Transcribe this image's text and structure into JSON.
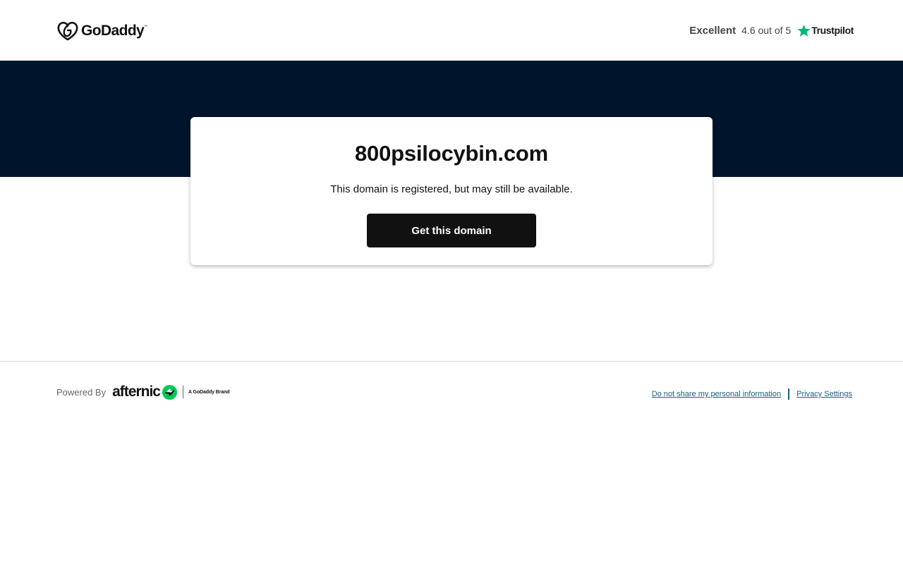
{
  "header": {
    "logo_text": "GoDaddy",
    "logo_tm": "™",
    "rating_word": "Excellent",
    "rating_score": "4.6 out of 5",
    "trustpilot_label": "Trustpilot"
  },
  "card": {
    "domain": "800psilocybin.com",
    "status": "This domain is registered, but may still be available.",
    "cta_label": "Get this domain"
  },
  "footer": {
    "powered_by": "Powered By",
    "afternic_text": "afternic",
    "brand_text": "A GoDaddy Brand",
    "links": [
      "Do not share my personal information",
      "Privacy Settings"
    ]
  },
  "colors": {
    "banner": "#00142c",
    "button": "#111111",
    "trustpilot_star": "#00b67a",
    "afternic_green": "#00c853",
    "link": "#1a6178"
  },
  "icons": {
    "logo": "godaddy-heart-icon",
    "trustpilot": "star-icon",
    "afternic": "afternic-arrows-icon"
  }
}
